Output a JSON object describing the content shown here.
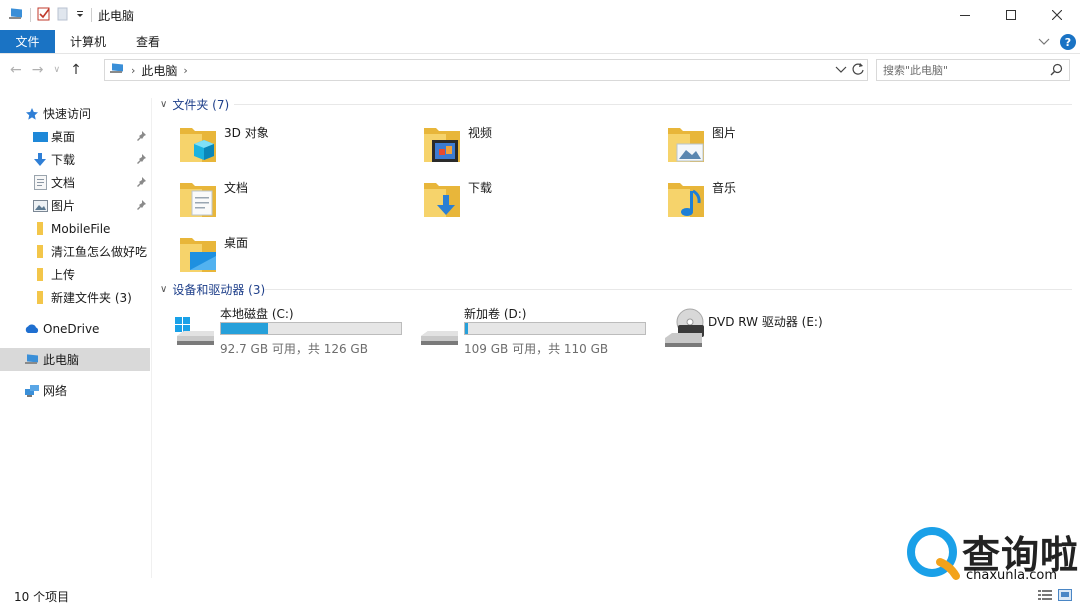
{
  "window": {
    "title": "此电脑"
  },
  "ribbon": {
    "tabs": [
      "文件",
      "计算机",
      "查看"
    ],
    "help_label": "?"
  },
  "address": {
    "path": "此电脑",
    "search_placeholder": "搜索\"此电脑\""
  },
  "sidebar": {
    "items": [
      {
        "label": "快速访问",
        "icon": "star-icon"
      },
      {
        "label": "桌面",
        "icon": "desktop-icon",
        "pinned": true
      },
      {
        "label": "下载",
        "icon": "download-icon",
        "pinned": true
      },
      {
        "label": "文档",
        "icon": "document-icon",
        "pinned": true
      },
      {
        "label": "图片",
        "icon": "pictures-icon",
        "pinned": true
      },
      {
        "label": "MobileFile",
        "icon": "folder-icon"
      },
      {
        "label": "清江鱼怎么做好吃",
        "icon": "folder-icon"
      },
      {
        "label": "上传",
        "icon": "folder-icon"
      },
      {
        "label": "新建文件夹 (3)",
        "icon": "folder-icon"
      },
      {
        "label": "OneDrive",
        "icon": "cloud-icon"
      },
      {
        "label": "此电脑",
        "icon": "computer-icon",
        "selected": true
      },
      {
        "label": "网络",
        "icon": "network-icon"
      }
    ]
  },
  "main": {
    "folders_header": "文件夹 (7)",
    "folders": [
      {
        "label": "3D 对象",
        "icon": "3d-objects-folder-icon"
      },
      {
        "label": "视频",
        "icon": "videos-folder-icon"
      },
      {
        "label": "图片",
        "icon": "pictures-folder-icon"
      },
      {
        "label": "文档",
        "icon": "documents-folder-icon"
      },
      {
        "label": "下载",
        "icon": "downloads-folder-icon"
      },
      {
        "label": "音乐",
        "icon": "music-folder-icon"
      },
      {
        "label": "桌面",
        "icon": "desktop-folder-icon"
      }
    ],
    "drives_header": "设备和驱动器 (3)",
    "drives": [
      {
        "label": "本地磁盘 (C:)",
        "free": "92.7 GB 可用，共 126 GB",
        "used_fraction": 0.26
      },
      {
        "label": "新加卷 (D:)",
        "free": "109 GB 可用，共 110 GB",
        "used_fraction": 0.01
      },
      {
        "label": "DVD RW 驱动器 (E:)"
      }
    ]
  },
  "status": {
    "count": "10 个项目"
  },
  "watermark": {
    "text": "查询啦",
    "url": "chaxunla.com"
  },
  "colors": {
    "accent": "#1a73c4",
    "bar_fill": "#26a0da",
    "group_header": "#1e3f8a",
    "folder": "#f3c64a"
  }
}
